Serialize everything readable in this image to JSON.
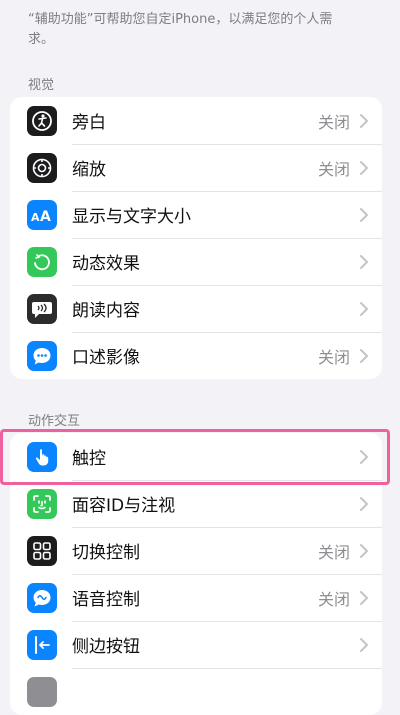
{
  "intro_text": "“辅助功能”可帮助您自定iPhone，以满足您的个人需求。",
  "vision": {
    "header": "视觉",
    "items": [
      {
        "label": "旁白",
        "value": "关闭",
        "icon": "voiceover-icon",
        "color": "#1c1c1e"
      },
      {
        "label": "缩放",
        "value": "关闭",
        "icon": "zoom-icon",
        "color": "#1c1c1e"
      },
      {
        "label": "显示与文字大小",
        "value": "",
        "icon": "text-size-icon",
        "color": "#0a84ff"
      },
      {
        "label": "动态效果",
        "value": "",
        "icon": "motion-icon",
        "color": "#34c759"
      },
      {
        "label": "朗读内容",
        "value": "",
        "icon": "spoken-content-icon",
        "color": "#2c2c2e"
      },
      {
        "label": "口述影像",
        "value": "关闭",
        "icon": "audio-description-icon",
        "color": "#0a84ff"
      }
    ]
  },
  "interaction": {
    "header": "动作交互",
    "items": [
      {
        "label": "触控",
        "value": "",
        "icon": "touch-icon",
        "color": "#0a84ff"
      },
      {
        "label": "面容ID与注视",
        "value": "",
        "icon": "face-id-icon",
        "color": "#34c759"
      },
      {
        "label": "切换控制",
        "value": "关闭",
        "icon": "switch-control-icon",
        "color": "#1c1c1e"
      },
      {
        "label": "语音控制",
        "value": "关闭",
        "icon": "voice-control-icon",
        "color": "#0a84ff"
      },
      {
        "label": "侧边按钮",
        "value": "",
        "icon": "side-button-icon",
        "color": "#0a84ff"
      }
    ]
  },
  "highlight_color": "#f0609e"
}
